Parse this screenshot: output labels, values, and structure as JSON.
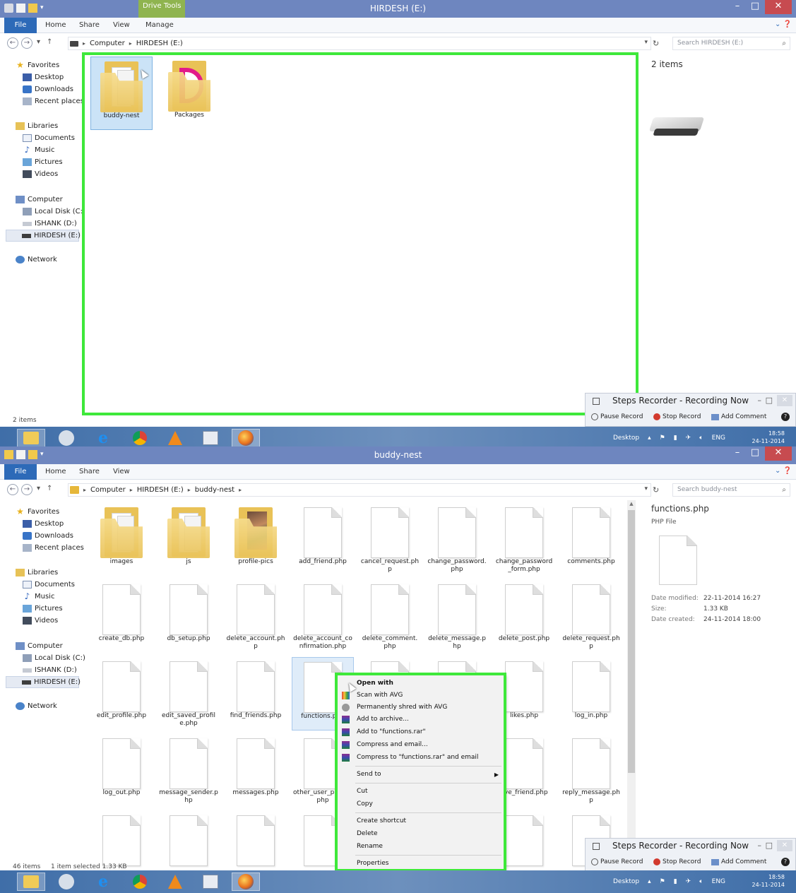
{
  "pane1": {
    "titlebar": {
      "context_tab": "Drive Tools",
      "title": "HIRDESH (E:)"
    },
    "menu": {
      "file": "File",
      "home": "Home",
      "share": "Share",
      "view": "View",
      "manage": "Manage"
    },
    "address": {
      "crumbs": [
        "Computer",
        "HIRDESH (E:)"
      ],
      "search_placeholder": "Search HIRDESH (E:)"
    },
    "items": [
      {
        "name": "buddy-nest",
        "type": "folder",
        "selected": true
      },
      {
        "name": "Packages",
        "type": "packages"
      }
    ],
    "preview": {
      "count": "2 items"
    },
    "status": "2 items"
  },
  "pane2": {
    "titlebar": {
      "title": "buddy-nest"
    },
    "menu": {
      "file": "File",
      "home": "Home",
      "share": "Share",
      "view": "View"
    },
    "address": {
      "crumbs": [
        "Computer",
        "HIRDESH (E:)",
        "buddy-nest"
      ],
      "search_placeholder": "Search buddy-nest"
    },
    "items": [
      {
        "name": "images",
        "type": "folder"
      },
      {
        "name": "js",
        "type": "folder"
      },
      {
        "name": "profile-pics",
        "type": "folder-photo"
      },
      {
        "name": "add_friend.php",
        "type": "file"
      },
      {
        "name": "cancel_request.php",
        "type": "file"
      },
      {
        "name": "change_password.php",
        "type": "file"
      },
      {
        "name": "change_password_form.php",
        "type": "file"
      },
      {
        "name": "comments.php",
        "type": "file"
      },
      {
        "name": "create_db.php",
        "type": "file"
      },
      {
        "name": "db_setup.php",
        "type": "file"
      },
      {
        "name": "delete_account.php",
        "type": "file"
      },
      {
        "name": "delete_account_confirmation.php",
        "type": "file"
      },
      {
        "name": "delete_comment.php",
        "type": "file"
      },
      {
        "name": "delete_message.php",
        "type": "file"
      },
      {
        "name": "delete_post.php",
        "type": "file"
      },
      {
        "name": "delete_request.php",
        "type": "file"
      },
      {
        "name": "edit_profile.php",
        "type": "file"
      },
      {
        "name": "edit_saved_profile.php",
        "type": "file"
      },
      {
        "name": "find_friends.php",
        "type": "file"
      },
      {
        "name": "functions.php",
        "type": "file",
        "selected": true
      },
      {
        "name": "",
        "type": "file"
      },
      {
        "name": "",
        "type": "file"
      },
      {
        "name": "likes.php",
        "type": "file"
      },
      {
        "name": "log_in.php",
        "type": "file"
      },
      {
        "name": "log_out.php",
        "type": "file"
      },
      {
        "name": "message_sender.php",
        "type": "file"
      },
      {
        "name": "messages.php",
        "type": "file"
      },
      {
        "name": "other_user_profile.php",
        "type": "file"
      },
      {
        "name": "",
        "type": "file"
      },
      {
        "name": "",
        "type": "file"
      },
      {
        "name": "ove_friend.php",
        "type": "file"
      },
      {
        "name": "reply_message.php",
        "type": "file"
      },
      {
        "name": "",
        "type": "file"
      },
      {
        "name": "",
        "type": "file"
      },
      {
        "name": "",
        "type": "file"
      },
      {
        "name": "",
        "type": "file"
      },
      {
        "name": "",
        "type": "file"
      },
      {
        "name": "",
        "type": "file"
      },
      {
        "name": "",
        "type": "file"
      },
      {
        "name": "",
        "type": "file"
      }
    ],
    "preview": {
      "name": "functions.php",
      "type": "PHP File",
      "date_modified_label": "Date modified:",
      "date_modified": "22-11-2014 16:27",
      "size_label": "Size:",
      "size": "1.33 KB",
      "date_created_label": "Date created:",
      "date_created": "24-11-2014 18:00"
    },
    "status_count": "46 items",
    "status_selected": "1 item selected  1.33 KB",
    "context_menu": {
      "open_with": "Open with",
      "scan_avg": "Scan with AVG",
      "shred_avg": "Permanently shred with AVG",
      "add_archive": "Add to archive...",
      "add_rar": "Add to \"functions.rar\"",
      "compress_email": "Compress and email...",
      "compress_rar_email": "Compress to \"functions.rar\" and email",
      "send_to": "Send to",
      "cut": "Cut",
      "copy": "Copy",
      "create_shortcut": "Create shortcut",
      "delete": "Delete",
      "rename": "Rename",
      "properties": "Properties"
    }
  },
  "nav": {
    "favorites": "Favorites",
    "desktop": "Desktop",
    "downloads": "Downloads",
    "recent": "Recent places",
    "libraries": "Libraries",
    "documents": "Documents",
    "music": "Music",
    "pictures": "Pictures",
    "videos": "Videos",
    "computer": "Computer",
    "local_disk": "Local Disk (C:)",
    "ishank": "ISHANK (D:)",
    "hirdesh": "HIRDESH (E:)",
    "network": "Network"
  },
  "steps": {
    "title": "Steps Recorder - Recording Now",
    "pause": "Pause Record",
    "stop": "Stop Record",
    "comment": "Add Comment"
  },
  "taskbar": {
    "desktop": "Desktop",
    "lang": "ENG",
    "time": "18:58",
    "date": "24-11-2014"
  },
  "colors": {
    "highlight": "#3ee83a",
    "titlebar": "#6e86bf",
    "file_tab": "#2d6ab8"
  }
}
